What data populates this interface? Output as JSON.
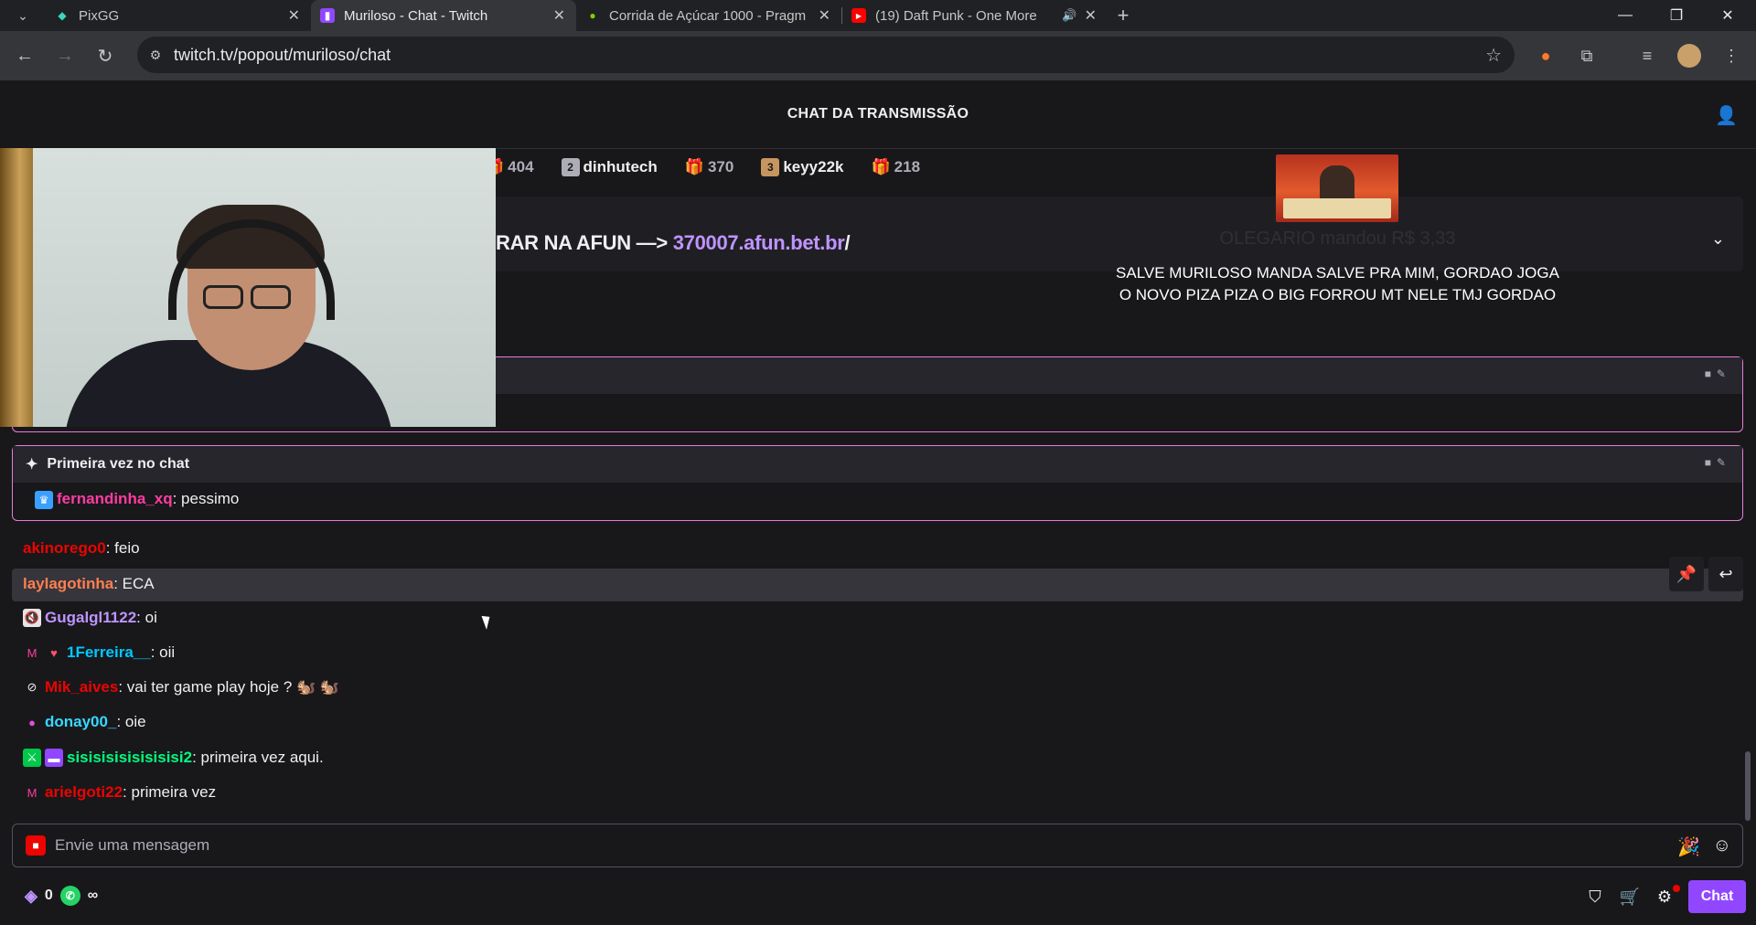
{
  "browser": {
    "tabs": [
      {
        "title": "PixGG",
        "active": false
      },
      {
        "title": "Muriloso - Chat - Twitch",
        "active": true
      },
      {
        "title": "Corrida de Açúcar 1000 - Pragm",
        "active": false
      },
      {
        "title": "(19) Daft Punk - One More",
        "active": false
      }
    ],
    "url": "twitch.tv/popout/muriloso/chat"
  },
  "chat": {
    "header_title": "CHAT DA TRANSMISSÃO",
    "leaderboard": [
      {
        "value": "404"
      },
      {
        "name": "dinhutech",
        "rank": "2"
      },
      {
        "value": "370"
      },
      {
        "name": "keyy22k",
        "rank": "3"
      },
      {
        "value": "218"
      }
    ],
    "pinned": {
      "text": "RAR NA AFUN —> ",
      "link": "370007.afun.bet.br",
      "suffix": "/"
    },
    "alert": {
      "title": "OLEGARIO mandou R$ 3,33",
      "message": "SALVE MURILOSO MANDA SALVE PRA MIM, GORDAO JOGA O NOVO PIZA PIZA O BIG FORROU MT NELE TMJ GORDAO"
    },
    "first_time": {
      "label": "Primeira vez no chat",
      "user": "fernandinha_xq",
      "text": "pessimo"
    },
    "messages": [
      {
        "user": "akinorego0",
        "color": "#eb0400",
        "text": "feio"
      },
      {
        "user": "laylagotinha",
        "color": "#ff7f50",
        "text": "ECA"
      },
      {
        "user": "Gugalgl1122",
        "color": "#bf94ff",
        "text": "oi"
      },
      {
        "user": "1Ferreira__",
        "color": "#00c8ff",
        "text": "oii"
      },
      {
        "user": "Mik_aives",
        "color": "#eb0400",
        "text": "vai ter game play hoje ? 🐿️ 🐿️"
      },
      {
        "user": "donay00_",
        "color": "#3ad7ff",
        "text": "oie"
      },
      {
        "user": "sisisisisisisisisi2",
        "color": "#00ff7f",
        "text": "primeira vez aqui."
      },
      {
        "user": "arielgoti22",
        "color": "#eb0400",
        "text": "primeira vez"
      }
    ],
    "input_placeholder": "Envie uma mensagem",
    "points": "0",
    "infinity": "∞",
    "chat_button": "Chat"
  },
  "colors": {
    "accent": "#9147ff",
    "highlight_border": "#e57cd8",
    "link": "#bf94ff"
  }
}
